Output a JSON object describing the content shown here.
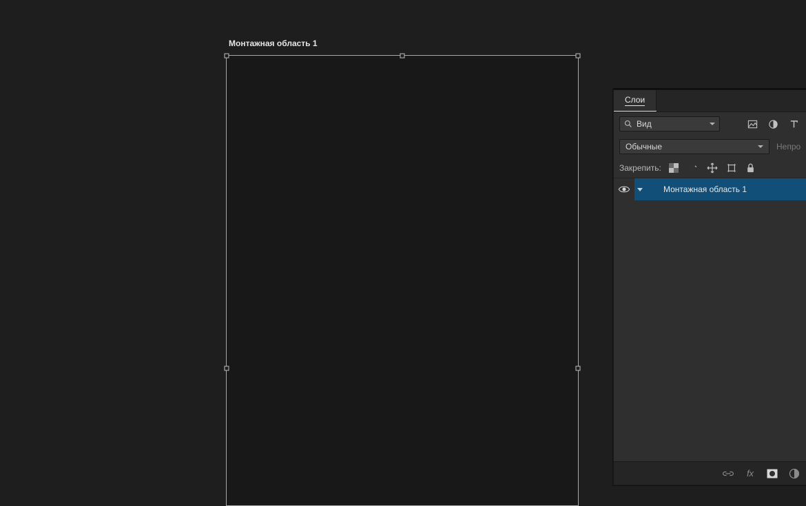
{
  "canvas": {
    "artboard_label": "Монтажная область 1"
  },
  "panel": {
    "tab_label": "Слои",
    "kind_dropdown": "Вид",
    "blend_mode": "Обычные",
    "opacity_label": "Непро",
    "lock_label": "Закрепить:",
    "layers": [
      {
        "name": "Монтажная область 1"
      }
    ]
  },
  "colors": {
    "bg": "#1e1e1e",
    "panel": "#2f2f2f",
    "panel_dark": "#252525",
    "selection": "#114f78"
  }
}
